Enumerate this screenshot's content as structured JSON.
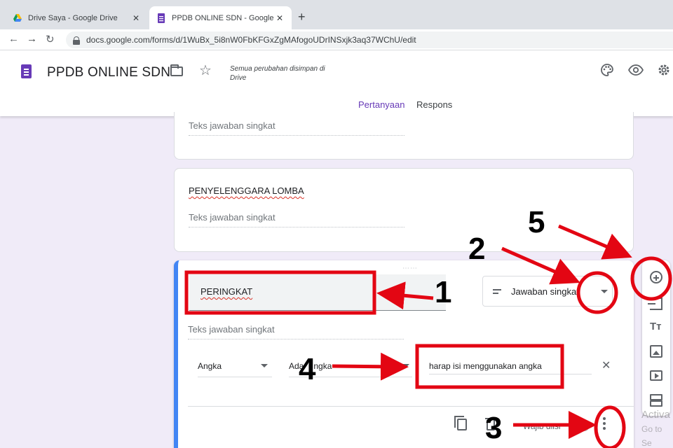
{
  "browser": {
    "tabs": [
      {
        "title": "Drive Saya - Google Drive",
        "active": false,
        "icon": "google-drive-icon"
      },
      {
        "title": "PPDB ONLINE SDN - Google For",
        "active": true,
        "icon": "google-forms-icon"
      }
    ],
    "close_glyph": "✕",
    "new_tab_glyph": "+",
    "url": "docs.google.com/forms/d/1WuBx_5i8nW0FbKFGxZgMAfogoUDrINSxjk3aq37WChU/edit"
  },
  "form_header": {
    "title": "PPDB ONLINE SDN",
    "save_status": "Semua perubahan disimpan di Drive",
    "tabs": [
      "Pertanyaan",
      "Respons"
    ],
    "active_tab": "Pertanyaan",
    "accent_color": "#673ab7"
  },
  "questions": [
    {
      "title": "",
      "placeholder": "Teks jawaban singkat"
    },
    {
      "title": "PENYELENGGARA LOMBA",
      "placeholder": "Teks jawaban singkat"
    }
  ],
  "active_question": {
    "title": "PERINGKAT",
    "type": "Jawaban singkat",
    "placeholder": "Teks jawaban singkat",
    "validation": {
      "category": "Angka",
      "condition_visible": "Ada",
      "condition_visible_tail": "ngka",
      "error_text": "harap isi menggunakan angka"
    },
    "required_label": "Wajib diisi",
    "required_on": false
  },
  "side_toolbar": [
    "add-question-icon",
    "import-questions-icon",
    "add-title-icon",
    "add-image-icon",
    "add-video-icon",
    "add-section-icon"
  ],
  "watermark": {
    "line1": "Activa",
    "line2": "Go to Se"
  },
  "annotations": {
    "labels": [
      "1",
      "2",
      "3",
      "4",
      "5"
    ],
    "color": "#e30613"
  }
}
